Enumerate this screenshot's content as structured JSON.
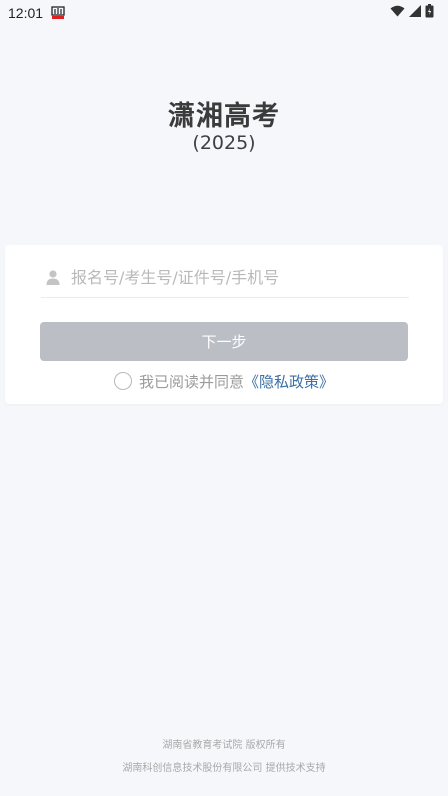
{
  "status_bar": {
    "time": "12:01"
  },
  "header": {
    "title": "潇湘高考",
    "subtitle": "(2025)"
  },
  "login_form": {
    "account_placeholder": "报名号/考生号/证件号/手机号",
    "account_value": "",
    "next_label": "下一步",
    "agree_text": "我已阅读并同意",
    "privacy_link": "《隐私政策》"
  },
  "footer": {
    "copyright": "湖南省教育考试院 版权所有",
    "support": "湖南科创信息技术股份有限公司 提供技术支持"
  },
  "colors": {
    "background": "#f6f7fb",
    "button_disabled": "#bcbec6",
    "link": "#3b6fa6",
    "app_icon_red": "#e02020"
  }
}
